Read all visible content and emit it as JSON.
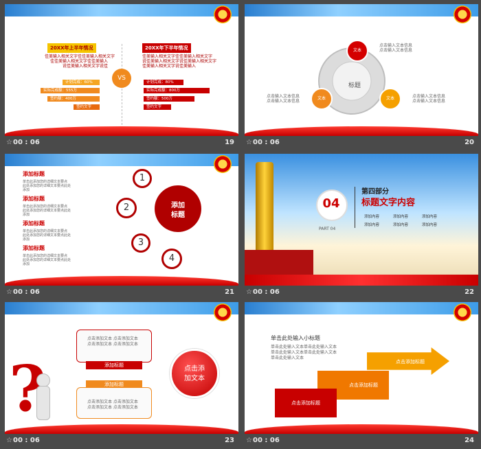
{
  "colors": {
    "red": "#c80000",
    "orange": "#f08a1e",
    "gray": "#4a4a4a",
    "yellow": "#f5c400"
  },
  "slides": [
    {
      "time": "00 : 06",
      "number": "19",
      "left_title": "20XX年上半年情况",
      "right_title": "20XX年下半年情况",
      "left_text": [
        "佳美输入相关文字佳佳美输入相关文字",
        "佳佳美输入相关文字佳佳美输入",
        "说佳美输入相关文字说佳"
      ],
      "right_text": [
        "佳美输入相关文字佳佳美输入相关文字",
        "说佳美输入相关文字说佳美输入相关文字",
        "佳美输入相关文字说佳美输入"
      ],
      "vs": "VS",
      "left_bars": [
        "计划完成：60%",
        "实际完成额：555万",
        "签约额：400万",
        "签约文字"
      ],
      "right_bars": [
        "计划完成：80%",
        "实际完成额：800万",
        "签约额：500万",
        "签约文字"
      ]
    },
    {
      "time": "00 : 06",
      "number": "20",
      "center": "标题",
      "node": "文本",
      "top_text": [
        "点击输入文本信息",
        "点击输入文本信息"
      ],
      "left_text": [
        "点击输入文本信息",
        "点击输入文本信息"
      ],
      "right_text": [
        "点击输入文本信息",
        "点击输入文本信息"
      ]
    },
    {
      "time": "00 : 06",
      "number": "21",
      "items": [
        {
          "title": "添加标题",
          "body": [
            "单击此添加您的详细文本要点",
            "此处添加您的详细文本要点此处",
            "添加"
          ]
        },
        {
          "title": "添加标题",
          "body": [
            "单击此添加您的详细文本要点",
            "此处添加您的详细文本要点此处",
            "添加"
          ]
        },
        {
          "title": "添加标题",
          "body": [
            "单击此添加您的详细文本要点",
            "此处添加您的详细文本要点此处",
            "添加"
          ]
        },
        {
          "title": "添加标题",
          "body": [
            "单击此添加您的详细文本要点",
            "此处添加您的详细文本要点此处",
            "添加"
          ]
        }
      ],
      "center": [
        "添加",
        "标题"
      ],
      "nums": [
        "1",
        "2",
        "3",
        "4"
      ]
    },
    {
      "time": "00 : 06",
      "number": "22",
      "section_no": "04",
      "section_title": "第四部分",
      "heading": "标题文字内容",
      "part": "PART 04",
      "items": [
        "添加内容",
        "添加内容",
        "添加内容",
        "添加内容",
        "添加内容",
        "添加内容"
      ]
    },
    {
      "time": "00 : 06",
      "number": "23",
      "box_top": [
        "点击添加文本 点击添加文本",
        "点击添加文本 点击添加文本"
      ],
      "box_bottom": [
        "点击添加文本 点击添加文本",
        "点击添加文本 点击添加文本"
      ],
      "bar1": "添加标题",
      "bar2": "添加标题",
      "circle": [
        "点击添",
        "加文本"
      ]
    },
    {
      "time": "00 : 06",
      "number": "24",
      "subtitle": "单击此处输入小标题",
      "lines": [
        "单击此处输入文本单击此处输入文本",
        "单击此处输入文本单击此处输入文本",
        "单击此处输入文本"
      ],
      "steps": [
        "点击添加标题",
        "点击添加标题",
        "点击添加标题"
      ]
    }
  ]
}
